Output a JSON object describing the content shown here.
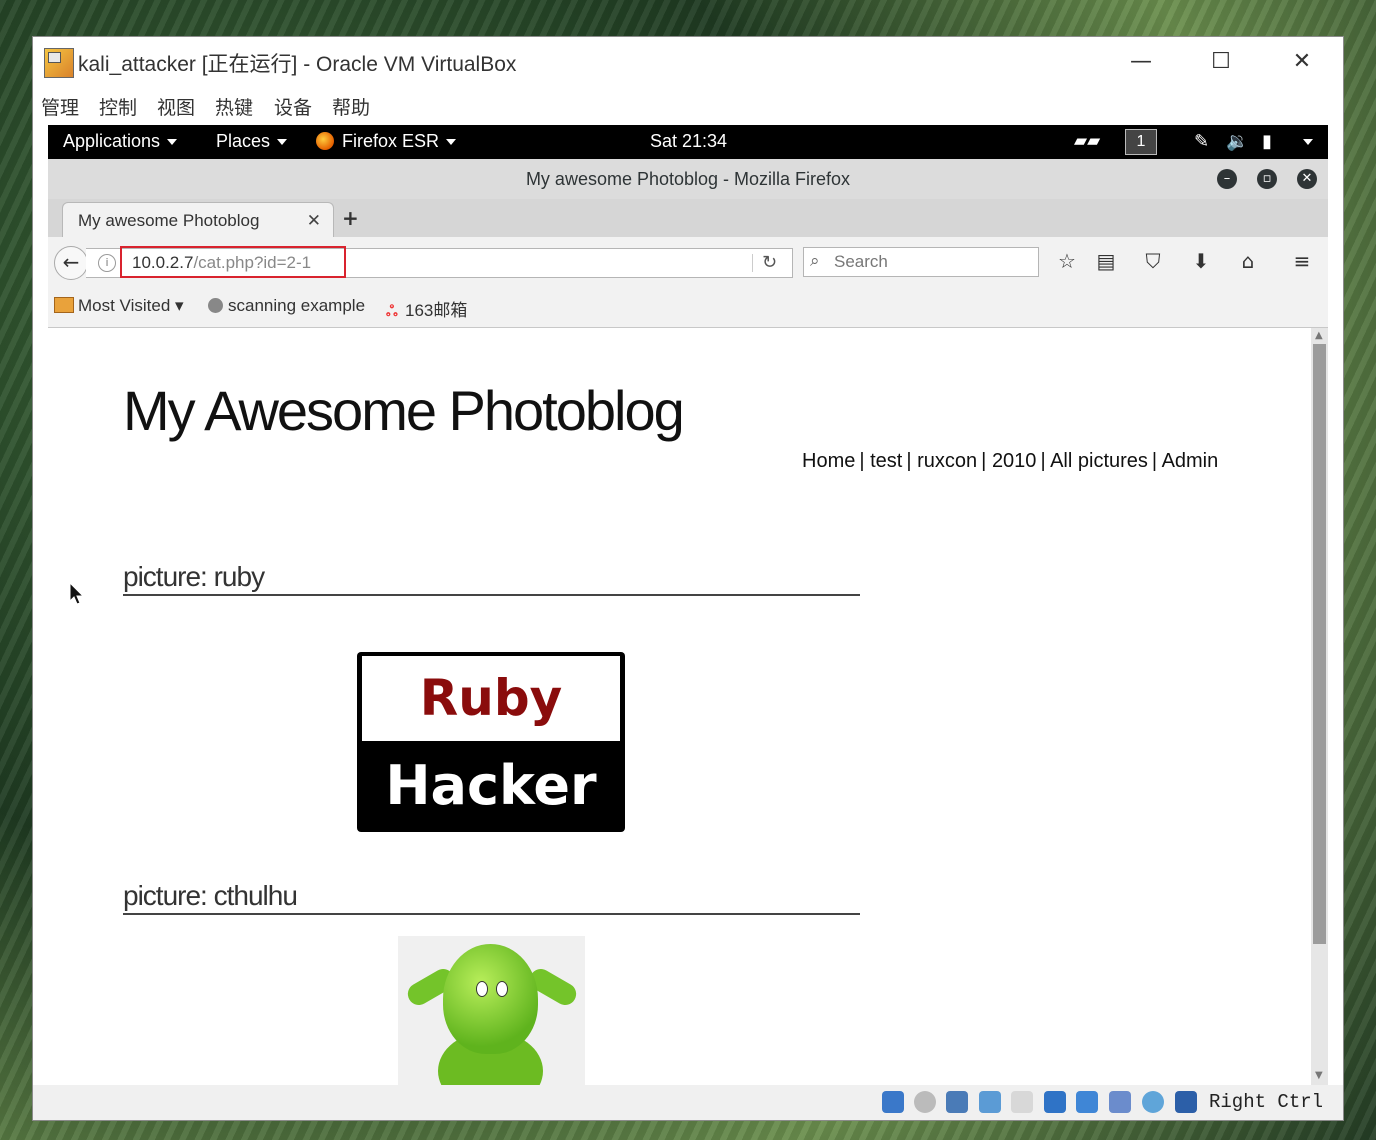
{
  "vbox": {
    "title": "kali_attacker [正在运行] - Oracle VM VirtualBox",
    "menu": [
      "管理",
      "控制",
      "视图",
      "热键",
      "设备",
      "帮助"
    ],
    "host_key": "Right Ctrl"
  },
  "topbar": {
    "applications": "Applications",
    "places": "Places",
    "firefox": "Firefox ESR",
    "clock": "Sat 21:34",
    "workspace": "1"
  },
  "firefox": {
    "window_title": "My awesome Photoblog - Mozilla Firefox",
    "tab_label": "My awesome Photoblog",
    "url_host": "10.0.2.7",
    "url_path": "/cat.php?id=2-1",
    "search_placeholder": "Search",
    "bookmarks": {
      "most_visited": "Most Visited",
      "scanning": "scanning example",
      "mail": "163邮箱"
    }
  },
  "page": {
    "title": "My Awesome Photoblog",
    "nav": [
      "Home",
      "test",
      "ruxcon",
      "2010",
      "All pictures",
      "Admin"
    ],
    "pictures": [
      {
        "heading": "picture: ruby",
        "image_text_top": "Ruby",
        "image_text_bottom": "Hacker"
      },
      {
        "heading": "picture: cthulhu"
      }
    ]
  }
}
